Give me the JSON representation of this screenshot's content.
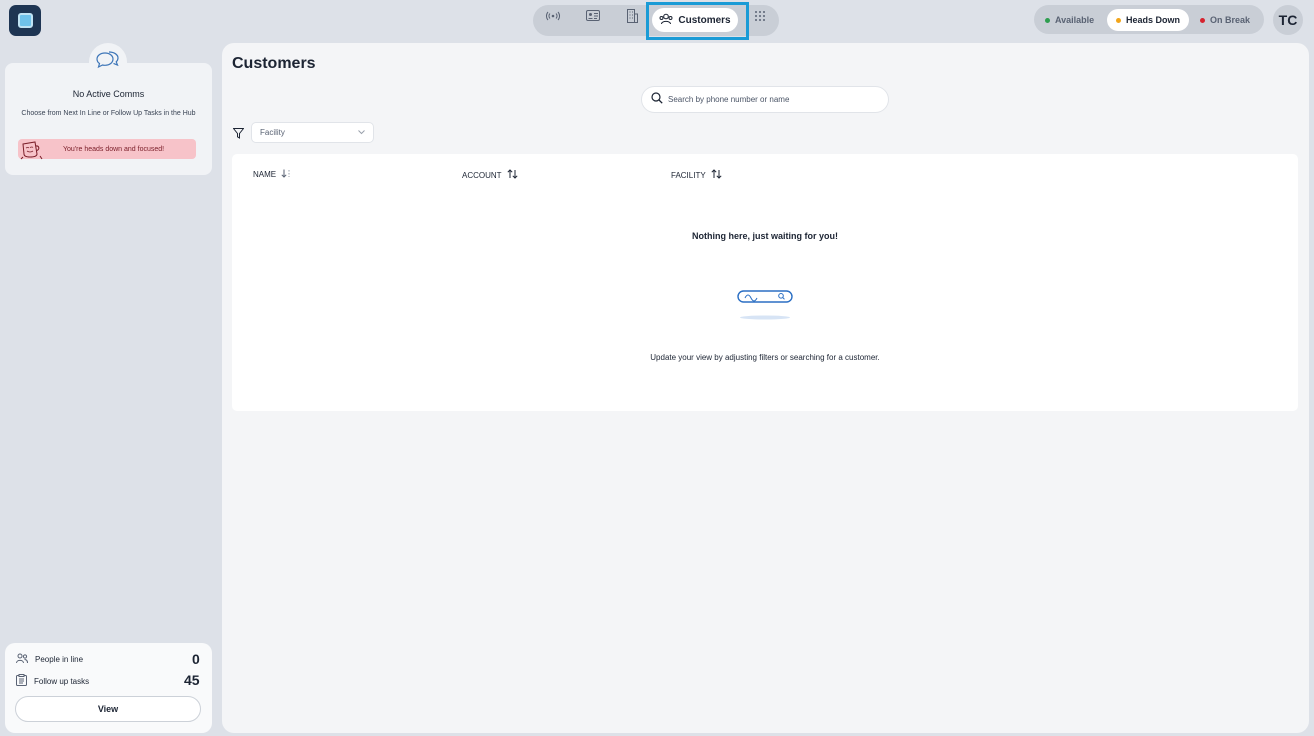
{
  "app": {
    "logo": "app-logo"
  },
  "nav": {
    "items": [
      {
        "icon": "broadcast-icon"
      },
      {
        "icon": "contact-card-icon"
      },
      {
        "icon": "building-icon"
      },
      {
        "icon": "people-icon",
        "label": "Customers",
        "active": true
      },
      {
        "icon": "dialpad-icon"
      }
    ]
  },
  "status": {
    "options": [
      {
        "label": "Available",
        "color": "#2e9e4f"
      },
      {
        "label": "Heads Down",
        "color": "#f2a51a",
        "active": true
      },
      {
        "label": "On Break",
        "color": "#d6232f"
      }
    ],
    "avatar": "TC"
  },
  "sidebar": {
    "comms_title": "No Active Comms",
    "comms_sub": "Choose from Next In Line or Follow Up Tasks in the Hub",
    "focus_banner": "You're heads down and focused!",
    "queue": [
      {
        "label": "People in line",
        "value": "0",
        "icon": "people-icon"
      },
      {
        "label": "Follow up tasks",
        "value": "45",
        "icon": "clipboard-icon"
      }
    ],
    "view_label": "View"
  },
  "main": {
    "title": "Customers",
    "search_placeholder": "Search by phone number or name",
    "facility_placeholder": "Facility",
    "columns": [
      {
        "label": "NAME"
      },
      {
        "label": "ACCOUNT"
      },
      {
        "label": "FACILITY"
      }
    ],
    "empty_title": "Nothing here, just waiting for you!",
    "empty_sub": "Update your view by adjusting filters or searching for a customer."
  }
}
